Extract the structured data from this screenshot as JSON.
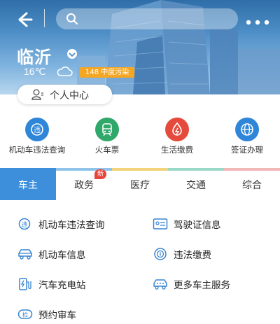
{
  "header": {
    "search_placeholder": "",
    "city": "临沂",
    "temperature": "16℃",
    "aqi_label": "148 中度污染",
    "user_center_label": "个人中心",
    "icons": [
      "back-arrow-icon",
      "search-icon",
      "more-icon",
      "cloud-icon",
      "chevron-down-icon",
      "user-icon"
    ]
  },
  "quick_actions": [
    {
      "label": "机动车违法查询",
      "icon": "violation-query-icon",
      "color": "#2f86d8"
    },
    {
      "label": "火车票",
      "icon": "train-icon",
      "color": "#2fa86a"
    },
    {
      "label": "生活缴费",
      "icon": "payment-icon",
      "color": "#e54b3c"
    },
    {
      "label": "签证办理",
      "icon": "globe-icon",
      "color": "#2f86d8"
    }
  ],
  "tabs": [
    {
      "label": "车主",
      "active": true,
      "accent": "#3d8fdb"
    },
    {
      "label": "政务",
      "badge": "新",
      "accent": "#8fc3ea"
    },
    {
      "label": "医疗",
      "accent": "#f2d27a"
    },
    {
      "label": "交通",
      "accent": "#9ad8c8"
    },
    {
      "label": "综合",
      "accent": "#f2b8b8"
    }
  ],
  "services": [
    {
      "label": "机动车违法查询",
      "icon": "violation-icon"
    },
    {
      "label": "驾驶证信息",
      "icon": "license-icon"
    },
    {
      "label": "机动车信息",
      "icon": "car-icon"
    },
    {
      "label": "违法缴费",
      "icon": "fine-payment-icon"
    },
    {
      "label": "汽车充电站",
      "icon": "charging-station-icon"
    },
    {
      "label": "更多车主服务",
      "icon": "car-more-icon"
    },
    {
      "label": "预约审车",
      "icon": "inspection-icon"
    }
  ],
  "colors": {
    "accent": "#3d8fdb",
    "aqi": "#f5a623",
    "icon_blue": "#3a86d1"
  }
}
